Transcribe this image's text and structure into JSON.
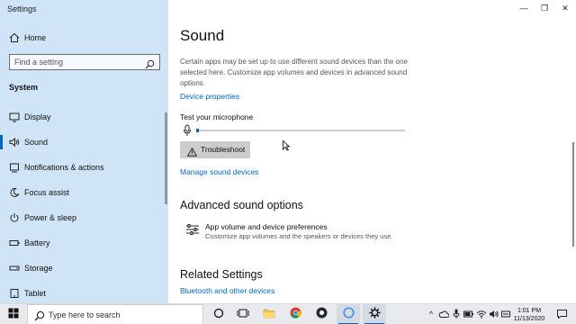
{
  "window": {
    "title": "Settings",
    "minimize_glyph": "—",
    "maximize_glyph": "❐",
    "close_glyph": "✕"
  },
  "sidebar": {
    "home_label": "Home",
    "search_placeholder": "Find a setting",
    "section_label": "System",
    "items": [
      {
        "label": "Display",
        "icon": "display-icon"
      },
      {
        "label": "Sound",
        "icon": "speaker-icon",
        "active": true
      },
      {
        "label": "Notifications & actions",
        "icon": "notifications-icon"
      },
      {
        "label": "Focus assist",
        "icon": "moon-icon"
      },
      {
        "label": "Power & sleep",
        "icon": "power-icon"
      },
      {
        "label": "Battery",
        "icon": "battery-icon"
      },
      {
        "label": "Storage",
        "icon": "storage-icon"
      },
      {
        "label": "Tablet",
        "icon": "tablet-icon"
      }
    ]
  },
  "main": {
    "title": "Sound",
    "description": "Certain apps may be set up to use different sound devices than the one selected here. Customize app volumes and devices in advanced sound options.",
    "device_properties_link": "Device properties",
    "test_mic_label": "Test your microphone",
    "mic_level": 0.01,
    "troubleshoot_label": "Troubleshoot",
    "manage_devices_link": "Manage sound devices",
    "advanced_heading": "Advanced sound options",
    "app_volume_title": "App volume and device preferences",
    "app_volume_subtitle": "Customize app volumes and the speakers or devices they use.",
    "related_heading": "Related Settings",
    "bluetooth_link": "Bluetooth and other devices"
  },
  "taskbar": {
    "search_placeholder": "Type here to search",
    "apps": [
      "task-view-icon",
      "timeline-icon",
      "file-explorer-icon",
      "chrome-icon",
      "obs-icon",
      "cortana-ring-icon",
      "settings-icon"
    ],
    "time": "1:01 PM",
    "date": "11/13/2020"
  },
  "colors": {
    "sidebar_bg": "#cfe4f7",
    "accent": "#0067c0",
    "button_bg": "#cccccc",
    "taskbar_bg": "#e8eaed"
  }
}
